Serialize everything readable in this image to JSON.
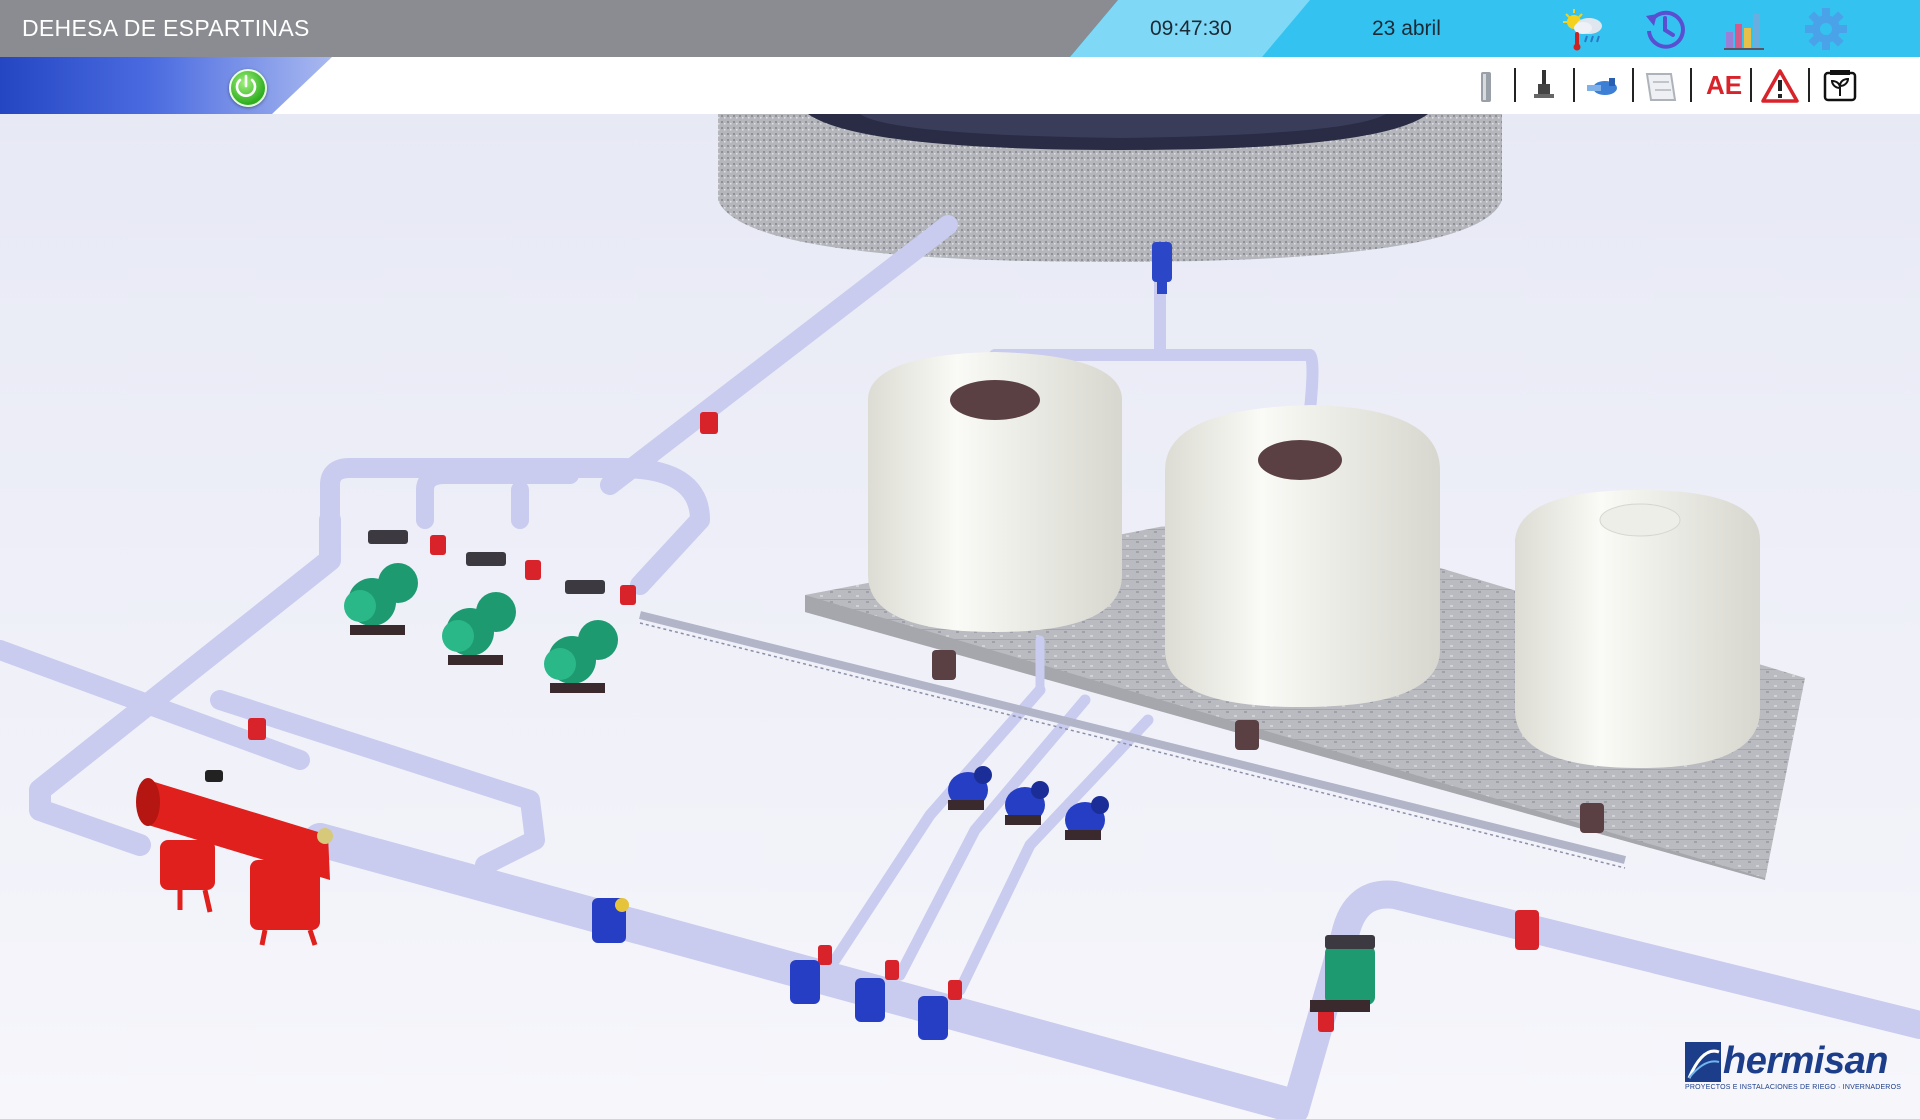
{
  "header": {
    "title": "DEHESA DE ESPARTINAS",
    "time": "09:47:30",
    "date": "23 abril",
    "icons": [
      "weather-icon",
      "history-icon",
      "statistics-icon",
      "settings-gear-icon"
    ]
  },
  "toolbar": {
    "tools": [
      "filter-icon",
      "valve-icon",
      "pump-icon",
      "map-icon",
      "ae-icon",
      "warning-icon",
      "fertilizer-icon"
    ],
    "ae_label": "AE"
  },
  "logo": {
    "name": "hermisan",
    "tagline": "PROYECTOS E INSTALACIONES DE RIEGO · INVERNADEROS"
  },
  "colors": {
    "topbar": "#8b8c91",
    "clock_band": "#34c3f0",
    "pipe": "#c9cbef",
    "tank": "#f7f7f2",
    "filter": "#e0201c",
    "pump_green": "#1d9a70",
    "pump_blue": "#263ec4",
    "valve_red": "#d8232a",
    "concrete": "#b7b9bf"
  }
}
